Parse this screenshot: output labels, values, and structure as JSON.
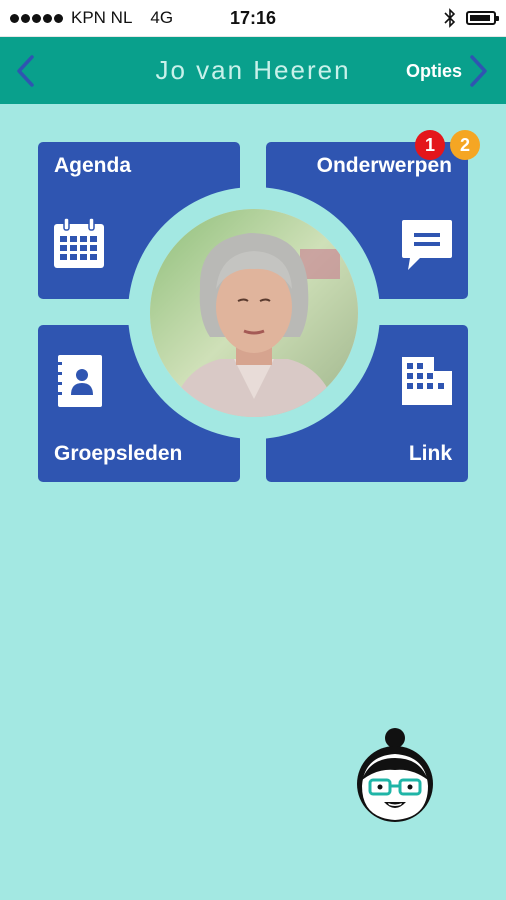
{
  "status_bar": {
    "carrier": "KPN NL",
    "network": "4G",
    "time": "17:16"
  },
  "nav": {
    "title": "Jo van Heeren",
    "options_label": "Opties"
  },
  "tiles": {
    "agenda": {
      "label": "Agenda",
      "icon": "calendar-icon"
    },
    "onderwerpen": {
      "label": "Onderwerpen",
      "icon": "chat-bubble-icon"
    },
    "groepsleden": {
      "label": "Groepsleden",
      "icon": "contacts-book-icon"
    },
    "link": {
      "label": "Link",
      "icon": "building-icon"
    }
  },
  "badges": {
    "red": "1",
    "orange": "2"
  },
  "colors": {
    "background": "#a3e8e2",
    "navbar": "#09a08c",
    "tile": "#2f55b1",
    "badge_red": "#e4161b",
    "badge_orange": "#f5a623"
  }
}
